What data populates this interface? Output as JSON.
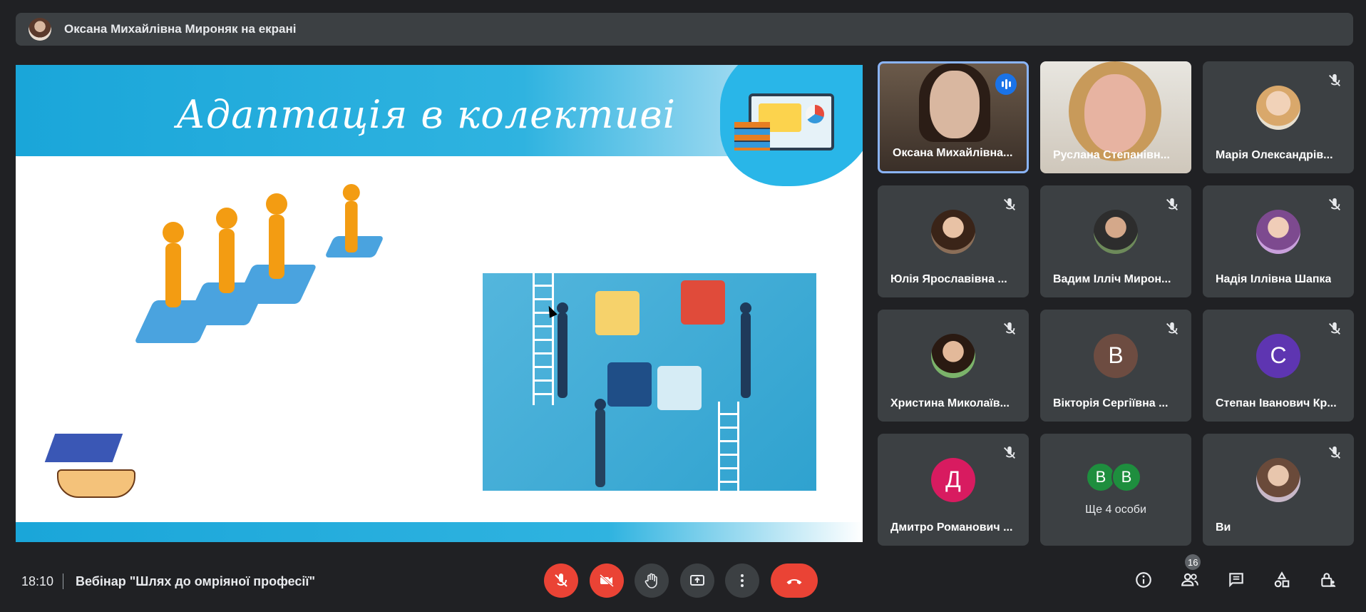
{
  "banner": {
    "text": "Оксана Михайлівна Мироняк на екрані"
  },
  "slide": {
    "title": "Адаптація в колективі"
  },
  "participants": [
    {
      "name": "Оксана Михайлівна...",
      "type": "video",
      "speaking": true
    },
    {
      "name": "Руслана Степанівн...",
      "type": "video"
    },
    {
      "name": "Марія Олександрів...",
      "type": "photo",
      "muted": true
    },
    {
      "name": "Юлія Ярославівна ...",
      "type": "photo",
      "muted": true
    },
    {
      "name": "Вадим Ілліч Мирон...",
      "type": "photo",
      "muted": true
    },
    {
      "name": "Надія Іллівна Шапка",
      "type": "photo",
      "muted": true
    },
    {
      "name": "Христина Миколаїв...",
      "type": "photo",
      "muted": true
    },
    {
      "name": "Вікторія Сергіївна ...",
      "type": "initial",
      "initial": "В",
      "color": "#6d4c41",
      "muted": true
    },
    {
      "name": "Степан Іванович Кр...",
      "type": "initial",
      "initial": "С",
      "color": "#5e35b1",
      "muted": true
    },
    {
      "name": "Дмитро Романович ...",
      "type": "initial",
      "initial": "Д",
      "color": "#d81b60",
      "muted": true
    },
    {
      "name": "",
      "type": "more",
      "initials": [
        "В",
        "В"
      ],
      "label": "Ще 4 особи"
    },
    {
      "name": "Ви",
      "type": "photo",
      "muted": true
    }
  ],
  "footer": {
    "time": "18:10",
    "meeting_title": "Вебінар \"Шлях до омріяної професії\"",
    "people_count": "16"
  },
  "colors": {
    "accent_red": "#ea4335",
    "speaker_blue": "#1a73e8",
    "tile_bg": "#3c4043",
    "page_bg": "#202124"
  }
}
